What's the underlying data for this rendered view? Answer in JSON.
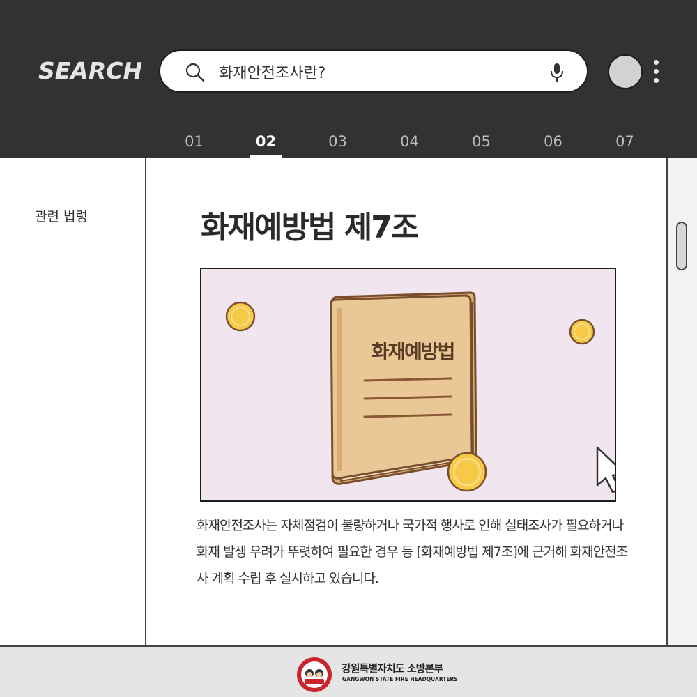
{
  "header": {
    "brand": "SEARCH",
    "search": {
      "value": "화재안전조사란?",
      "placeholder": "화재안전조사란?"
    },
    "icons": {
      "search": "search-icon",
      "mic": "microphone-icon",
      "avatar": "avatar",
      "more": "more-vertical-icon"
    }
  },
  "tabs": [
    {
      "label": "01",
      "active": false
    },
    {
      "label": "02",
      "active": true
    },
    {
      "label": "03",
      "active": false
    },
    {
      "label": "04",
      "active": false
    },
    {
      "label": "05",
      "active": false
    },
    {
      "label": "06",
      "active": false
    },
    {
      "label": "07",
      "active": false
    }
  ],
  "sidebar": {
    "label": "관련 법령"
  },
  "main": {
    "title": "화재예방법 제7조",
    "illustration": {
      "book_title": "화재예방법"
    },
    "body": "화재안전조사는 자체점검이 불량하거나 국가적 행사로 인해 실태조사가 필요하거나 화재 발생 우려가 뚜렷하여 필요한 경우 등 [화재예방법 제7조]에 근거해 화재안전조사 계획 수립 후 실시하고 있습니다."
  },
  "footer": {
    "org_name": "강원특별자치도 소방본부",
    "org_name_en": "GANGWON STATE FIRE HEADQUARTERS",
    "logo_text": "Gangwon State",
    "logo_number": "119",
    "logo_sub": "소방본부"
  },
  "colors": {
    "header_bg": "#333232",
    "illustration_bg": "#f1e6ef",
    "book": "#e9c896",
    "coin": "#f7c948",
    "footer_bg": "#e5e5e5"
  }
}
